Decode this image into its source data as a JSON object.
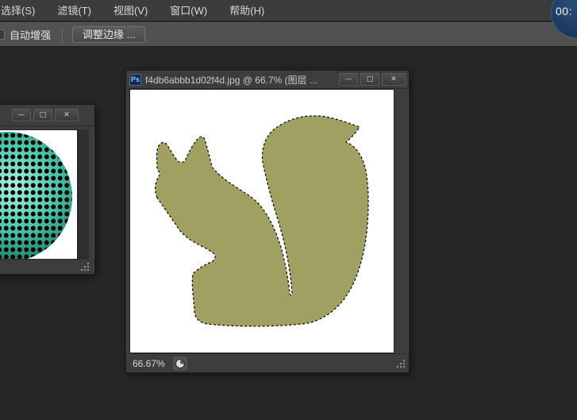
{
  "menu_bar": {
    "items": [
      {
        "label": "选择(S)"
      },
      {
        "label": "滤镜(T)"
      },
      {
        "label": "视图(V)"
      },
      {
        "label": "窗口(W)"
      },
      {
        "label": "帮助(H)"
      }
    ]
  },
  "options_bar": {
    "auto_enhance_label": "自动增强",
    "refine_edge_label": "调整边缘 ...",
    "auto_enhance_checked": false
  },
  "timer_badge": {
    "text": "00:",
    "bg_color": "#1d3a5f"
  },
  "document_window": {
    "icon_text": "Ps",
    "title": "f4db6abbb1d02f4d.jpg @ 66.7% (图层 ...",
    "window_controls": {
      "minimize": "—",
      "maximize": "□",
      "close": "✕"
    },
    "status": {
      "zoom": "66.67%"
    }
  },
  "secondary_window": {
    "window_controls": {
      "minimize": "—",
      "maximize": "□",
      "close": "✕"
    }
  },
  "canvas": {
    "content": "squirrel silhouette with marching-ants selection",
    "squirrel_color": "#a0a062",
    "selection_color": "#151515",
    "background": "#ffffff"
  },
  "secondary_canvas": {
    "content": "halftone dotted circle",
    "teal_color": "#49c4a8",
    "dot_color": "#0a0a0a"
  }
}
